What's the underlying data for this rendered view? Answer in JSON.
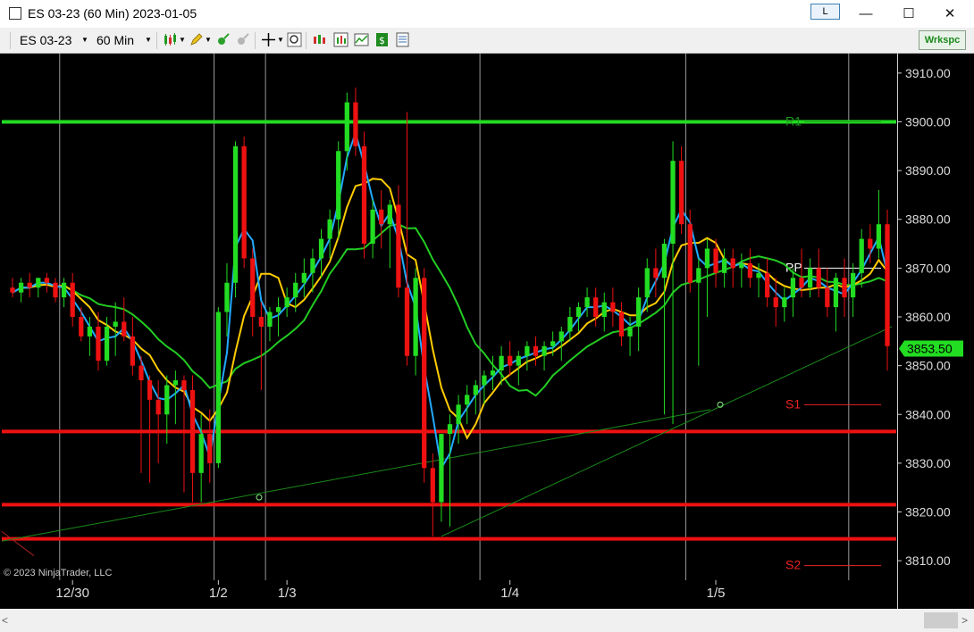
{
  "window": {
    "title": "ES 03-23 (60 Min)  2023-01-05",
    "link_button_label": "L",
    "minimize_glyph": "—",
    "maximize_glyph": "☐",
    "close_glyph": "✕"
  },
  "toolbar": {
    "instrument": "ES 03-23",
    "interval": "60 Min",
    "workspace_button": "Wrkspc",
    "icons": [
      "bar-type-icon",
      "drawing-pencil-icon",
      "zoom-in-icon",
      "zoom-out-icon",
      "crosshair-icon",
      "magnify-icon",
      "data-box-icon",
      "indicators-icon",
      "strategies-icon",
      "money-icon",
      "properties-icon"
    ]
  },
  "colors": {
    "background": "#000000",
    "up_candle": "#22dd22",
    "down_candle": "#ee1111",
    "fast_ma": "#22aaff",
    "mid_ma": "#ffcc00",
    "slow_ma": "#22cc22",
    "resistance": "#22dd22",
    "support": "#ee1111",
    "price_marker": "#22dd22"
  },
  "chart_data": {
    "type": "candlestick",
    "copyright": "© 2023 NinjaTrader, LLC",
    "ylim": [
      3806,
      3914
    ],
    "y_ticks": [
      3810,
      3820,
      3830,
      3840,
      3850,
      3860,
      3870,
      3880,
      3890,
      3900,
      3910
    ],
    "y_tick_labels": [
      "3810.00",
      "3820.00",
      "3830.00",
      "3840.00",
      "3850.00",
      "3860.00",
      "3870.00",
      "3880.00",
      "3890.00",
      "3900.00",
      "3910.00"
    ],
    "x_labels": [
      "12/30",
      "1/2",
      "1/3",
      "1/4",
      "1/5"
    ],
    "current_price": "3853.50",
    "pivot_labels": [
      "R1",
      "PP",
      "S1",
      "S2"
    ],
    "pivot_values": [
      3900,
      3870,
      3842,
      3809
    ],
    "levels": {
      "resistance": [
        3900
      ],
      "support": [
        3836.5,
        3821.5,
        3814.5
      ]
    },
    "candles": [
      [
        3866,
        3868,
        3864,
        3865
      ],
      [
        3865,
        3868,
        3863,
        3867
      ],
      [
        3867,
        3869,
        3864,
        3866
      ],
      [
        3866,
        3868,
        3864,
        3868
      ],
      [
        3868,
        3869,
        3865,
        3867
      ],
      [
        3867,
        3868,
        3863,
        3864
      ],
      [
        3864,
        3868,
        3862,
        3867
      ],
      [
        3867,
        3869,
        3858,
        3860
      ],
      [
        3860,
        3862,
        3855,
        3856
      ],
      [
        3856,
        3860,
        3852,
        3858
      ],
      [
        3858,
        3861,
        3849,
        3851
      ],
      [
        3851,
        3860,
        3850,
        3858
      ],
      [
        3858,
        3863,
        3852,
        3859
      ],
      [
        3859,
        3864,
        3855,
        3856
      ],
      [
        3856,
        3860,
        3848,
        3850
      ],
      [
        3850,
        3852,
        3828,
        3847
      ],
      [
        3847,
        3848,
        3826,
        3843
      ],
      [
        3843,
        3847,
        3830,
        3840
      ],
      [
        3840,
        3848,
        3834,
        3846
      ],
      [
        3846,
        3849,
        3838,
        3847
      ],
      [
        3847,
        3848,
        3824,
        3845
      ],
      [
        3845,
        3848,
        3822,
        3828
      ],
      [
        3828,
        3840,
        3822,
        3836
      ],
      [
        3836,
        3841,
        3826,
        3830
      ],
      [
        3830,
        3862,
        3829,
        3861
      ],
      [
        3861,
        3871,
        3856,
        3867
      ],
      [
        3867,
        3896,
        3864,
        3895
      ],
      [
        3895,
        3897,
        3870,
        3872
      ],
      [
        3872,
        3874,
        3856,
        3860
      ],
      [
        3860,
        3863,
        3845,
        3858
      ],
      [
        3858,
        3862,
        3855,
        3861
      ],
      [
        3861,
        3864,
        3856,
        3862
      ],
      [
        3862,
        3866,
        3860,
        3864
      ],
      [
        3864,
        3869,
        3861,
        3867
      ],
      [
        3867,
        3872,
        3864,
        3869
      ],
      [
        3869,
        3874,
        3865,
        3872
      ],
      [
        3872,
        3878,
        3868,
        3876
      ],
      [
        3876,
        3882,
        3872,
        3880
      ],
      [
        3880,
        3896,
        3876,
        3894
      ],
      [
        3894,
        3906,
        3890,
        3904
      ],
      [
        3904,
        3907,
        3893,
        3895
      ],
      [
        3895,
        3898,
        3872,
        3875
      ],
      [
        3875,
        3884,
        3872,
        3882
      ],
      [
        3882,
        3886,
        3874,
        3879
      ],
      [
        3879,
        3884,
        3870,
        3883
      ],
      [
        3883,
        3887,
        3864,
        3866
      ],
      [
        3866,
        3902,
        3850,
        3852
      ],
      [
        3852,
        3870,
        3848,
        3868
      ],
      [
        3868,
        3870,
        3826,
        3829
      ],
      [
        3829,
        3832,
        3815,
        3822
      ],
      [
        3822,
        3836,
        3818,
        3836
      ],
      [
        3836,
        3840,
        3817,
        3838
      ],
      [
        3838,
        3844,
        3834,
        3842
      ],
      [
        3842,
        3846,
        3838,
        3844
      ],
      [
        3844,
        3847,
        3840,
        3846
      ],
      [
        3846,
        3849,
        3842,
        3848
      ],
      [
        3848,
        3852,
        3845,
        3849
      ],
      [
        3849,
        3854,
        3846,
        3852
      ],
      [
        3852,
        3855,
        3848,
        3850
      ],
      [
        3850,
        3853,
        3846,
        3852
      ],
      [
        3852,
        3855,
        3849,
        3854
      ],
      [
        3854,
        3856,
        3850,
        3852
      ],
      [
        3852,
        3855,
        3849,
        3854
      ],
      [
        3854,
        3857,
        3852,
        3855
      ],
      [
        3855,
        3858,
        3851,
        3857
      ],
      [
        3857,
        3862,
        3855,
        3860
      ],
      [
        3860,
        3863,
        3857,
        3862
      ],
      [
        3862,
        3866,
        3860,
        3864
      ],
      [
        3864,
        3866,
        3858,
        3860
      ],
      [
        3860,
        3865,
        3857,
        3863
      ],
      [
        3863,
        3866,
        3858,
        3861
      ],
      [
        3861,
        3863,
        3854,
        3856
      ],
      [
        3856,
        3860,
        3852,
        3858
      ],
      [
        3858,
        3866,
        3853,
        3864
      ],
      [
        3864,
        3872,
        3861,
        3870
      ],
      [
        3870,
        3874,
        3864,
        3868
      ],
      [
        3868,
        3876,
        3840,
        3875
      ],
      [
        3875,
        3896,
        3838,
        3892
      ],
      [
        3892,
        3895,
        3877,
        3879
      ],
      [
        3879,
        3882,
        3865,
        3867
      ],
      [
        3867,
        3872,
        3850,
        3870
      ],
      [
        3870,
        3876,
        3860,
        3874
      ],
      [
        3874,
        3876,
        3866,
        3869
      ],
      [
        3869,
        3874,
        3866,
        3872
      ],
      [
        3872,
        3874,
        3866,
        3870
      ],
      [
        3870,
        3873,
        3866,
        3871
      ],
      [
        3871,
        3874,
        3866,
        3868
      ],
      [
        3868,
        3871,
        3864,
        3869
      ],
      [
        3869,
        3872,
        3862,
        3864
      ],
      [
        3864,
        3868,
        3858,
        3862
      ],
      [
        3862,
        3866,
        3859,
        3864
      ],
      [
        3864,
        3870,
        3860,
        3868
      ],
      [
        3868,
        3874,
        3864,
        3866
      ],
      [
        3866,
        3872,
        3864,
        3870
      ],
      [
        3870,
        3874,
        3864,
        3866
      ],
      [
        3866,
        3870,
        3860,
        3862
      ],
      [
        3862,
        3869,
        3857,
        3868
      ],
      [
        3868,
        3872,
        3860,
        3864
      ],
      [
        3864,
        3871,
        3860,
        3869
      ],
      [
        3869,
        3878,
        3866,
        3876
      ],
      [
        3876,
        3879,
        3871,
        3874
      ],
      [
        3874,
        3886,
        3872,
        3879
      ],
      [
        3879,
        3882,
        3849,
        3854
      ]
    ],
    "session_dividers": [
      6,
      24,
      30,
      55,
      79,
      98
    ]
  }
}
